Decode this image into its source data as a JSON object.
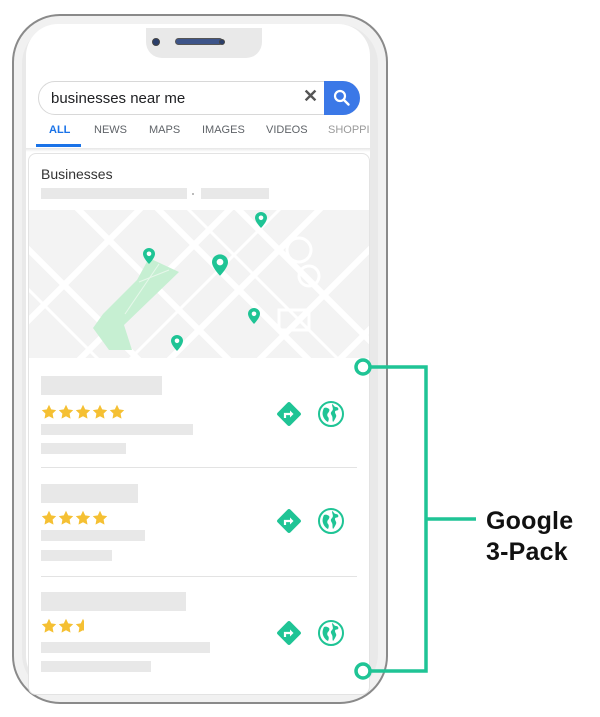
{
  "search": {
    "query": "businesses near me",
    "clear_icon": "close-icon",
    "submit_icon": "search-icon"
  },
  "tabs": [
    {
      "label": "ALL",
      "active": true
    },
    {
      "label": "NEWS",
      "active": false
    },
    {
      "label": "MAPS",
      "active": false
    },
    {
      "label": "IMAGES",
      "active": false
    },
    {
      "label": "VIDEOS",
      "active": false
    },
    {
      "label": "SHOPPI",
      "active": false
    }
  ],
  "results": {
    "section_title": "Businesses",
    "map_pins": 5,
    "listings": [
      {
        "rating": 5,
        "actions": [
          "directions-icon",
          "website-globe-icon"
        ]
      },
      {
        "rating": 4,
        "actions": [
          "directions-icon",
          "website-globe-icon"
        ]
      },
      {
        "rating": 2.5,
        "actions": [
          "directions-icon",
          "website-globe-icon"
        ]
      }
    ]
  },
  "annotation": {
    "line1": "Google",
    "line2": "3-Pack"
  },
  "colors": {
    "accent": "#1fc495",
    "star": "#f5c033",
    "search_blue": "#3b78e7",
    "tab_active": "#1a73e8",
    "park": "#c6efd2"
  }
}
